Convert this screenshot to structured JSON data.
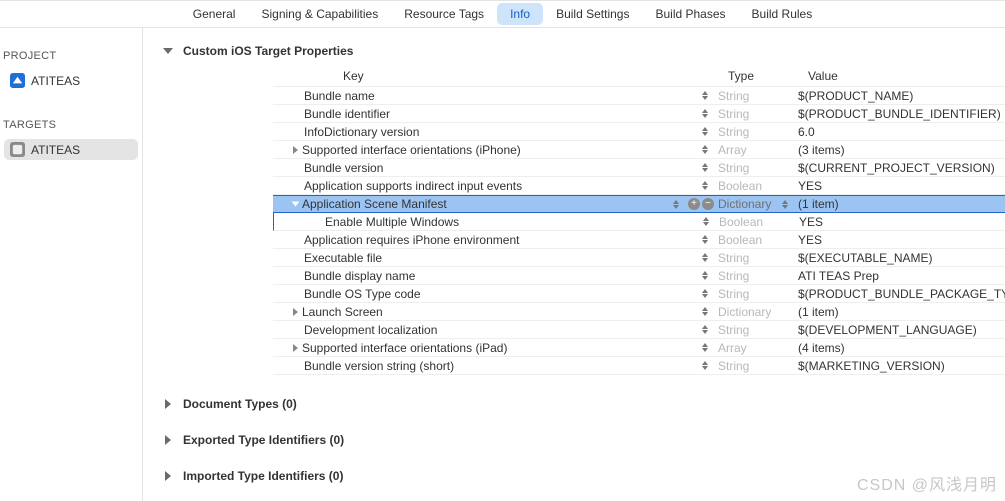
{
  "tabs": [
    "General",
    "Signing & Capabilities",
    "Resource Tags",
    "Info",
    "Build Settings",
    "Build Phases",
    "Build Rules"
  ],
  "selected_tab": "Info",
  "sidebar": {
    "project_heading": "PROJECT",
    "project_item": "ATITEAS",
    "targets_heading": "TARGETS",
    "target_item": "ATITEAS"
  },
  "sections": {
    "custom": "Custom iOS Target Properties",
    "doc": "Document Types (0)",
    "exp": "Exported Type Identifiers (0)",
    "imp": "Imported Type Identifiers (0)"
  },
  "columns": {
    "key": "Key",
    "type": "Type",
    "value": "Value"
  },
  "rows": [
    {
      "key": "Bundle name",
      "type": "String",
      "value": "$(PRODUCT_NAME)"
    },
    {
      "key": "Bundle identifier",
      "type": "String",
      "value": "$(PRODUCT_BUNDLE_IDENTIFIER)"
    },
    {
      "key": "InfoDictionary version",
      "type": "String",
      "value": "6.0"
    },
    {
      "key": "Supported interface orientations (iPhone)",
      "type": "Array",
      "value": "(3 items)",
      "disclosure": true
    },
    {
      "key": "Bundle version",
      "type": "String",
      "value": "$(CURRENT_PROJECT_VERSION)"
    },
    {
      "key": "Application supports indirect input events",
      "type": "Boolean",
      "value": "YES",
      "tailstep": true
    },
    {
      "key": "Application Scene Manifest",
      "type": "Dictionary",
      "value": "(1 item)",
      "disclosure": true,
      "open": true,
      "selected": true,
      "addrem": true,
      "typestep": true
    },
    {
      "key": "Enable Multiple Windows",
      "type": "Boolean",
      "value": "YES",
      "indent": 1,
      "selchild": true,
      "tailstep": true
    },
    {
      "key": "Application requires iPhone environment",
      "type": "Boolean",
      "value": "YES",
      "tailstep": true
    },
    {
      "key": "Executable file",
      "type": "String",
      "value": "$(EXECUTABLE_NAME)"
    },
    {
      "key": "Bundle display name",
      "type": "String",
      "value": "ATI TEAS Prep"
    },
    {
      "key": "Bundle OS Type code",
      "type": "String",
      "value": "$(PRODUCT_BUNDLE_PACKAGE_TYPE)"
    },
    {
      "key": "Launch Screen",
      "type": "Dictionary",
      "value": "(1 item)",
      "disclosure": true
    },
    {
      "key": "Development localization",
      "type": "String",
      "value": "$(DEVELOPMENT_LANGUAGE)"
    },
    {
      "key": "Supported interface orientations (iPad)",
      "type": "Array",
      "value": "(4 items)",
      "disclosure": true
    },
    {
      "key": "Bundle version string (short)",
      "type": "String",
      "value": "$(MARKETING_VERSION)"
    }
  ],
  "watermark": "CSDN @风浅月明"
}
